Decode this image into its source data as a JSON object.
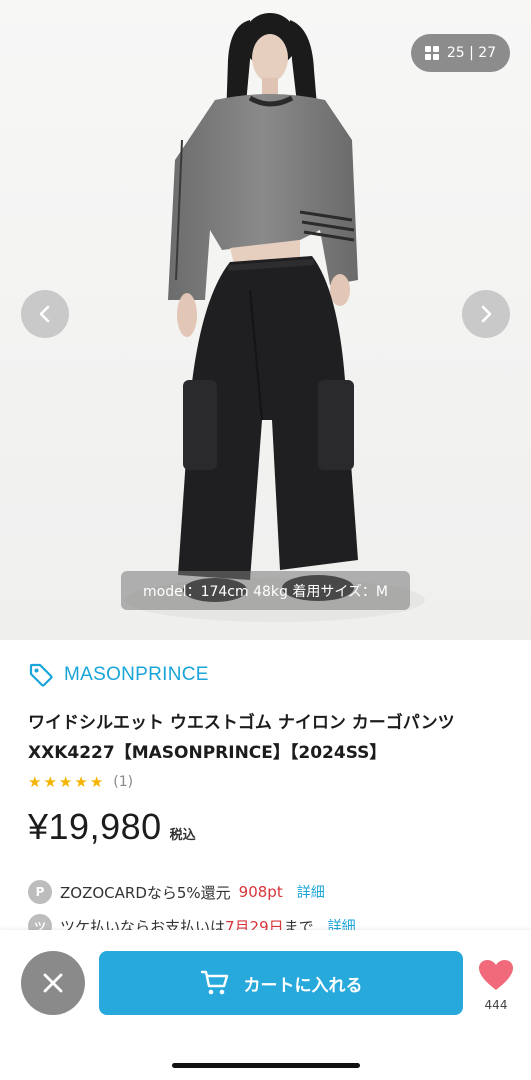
{
  "gallery": {
    "counter": "25 | 27",
    "caption": "model：174cm 48kg 着用サイズ：M"
  },
  "product": {
    "brand": "MASONPRINCE",
    "title": "ワイドシルエット ウエストゴム ナイロン カーゴパンツ XXK4227【MASONPRINCE】【2024SS】",
    "rating_stars": 5,
    "review_count": "(1)",
    "price": "¥19,980",
    "tax_label": "税込"
  },
  "info": {
    "points_icon": "P",
    "points_text": "ZOZOCARDなら5%還元",
    "points_value": "908pt",
    "points_link": "詳細",
    "tsuke_icon": "ツ",
    "tsuke_text_a": "ツケ払いならお支払いは",
    "tsuke_date": "7月29日",
    "tsuke_text_b": "まで",
    "tsuke_link": "詳細"
  },
  "actions": {
    "cart_label": "カートに入れる",
    "favorite_count": "444"
  },
  "colors": {
    "accent": "#27a9dc",
    "brand_link": "#1aa5d9",
    "heart": "#f06a7b",
    "star": "#f5b400",
    "highlight_red": "#d8353b"
  }
}
